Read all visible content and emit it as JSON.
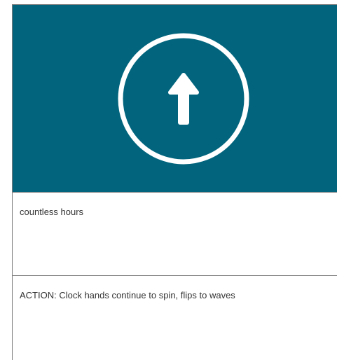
{
  "hero": {
    "icon": "arrow-up-icon",
    "background_color": "#02657d",
    "icon_color": "#ffffff"
  },
  "cards": [
    {
      "text": "countless hours"
    },
    {
      "text": "ACTION: Clock hands continue to spin, flips to waves"
    }
  ]
}
